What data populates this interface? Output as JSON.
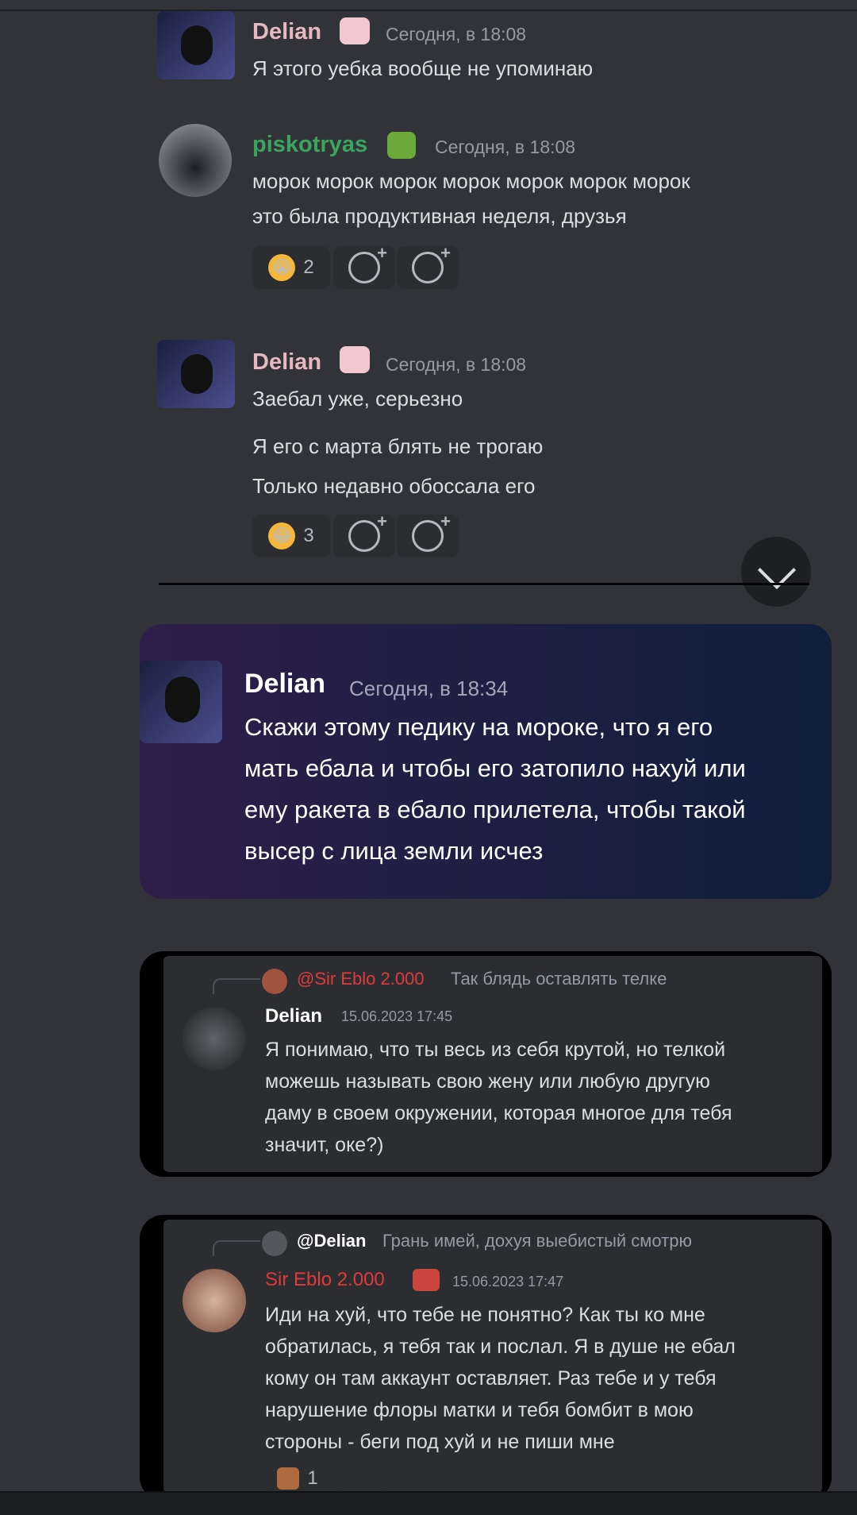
{
  "messages": [
    {
      "user": "Delian",
      "time": "Сегодня, в 18:08",
      "text": "Я этого уебка вообще не упоминаю",
      "name_color": "#e6b8c0"
    },
    {
      "user": "piskotryas",
      "time": "Сегодня, в 18:08",
      "lines": [
        "морок морок морок морок морок морок морок",
        "это была продуктивная неделя, друзья"
      ],
      "name_color": "#3ba55d",
      "reaction_count": "2"
    },
    {
      "user": "Delian",
      "time": "Сегодня, в 18:08",
      "lines": [
        "Заебал уже, серьезно",
        "Я его с марта блять не трогаю",
        "Только недавно обоссала его"
      ],
      "reaction_count": "3"
    }
  ],
  "featured": {
    "user": "Delian",
    "time": "Сегодня, в 18:34",
    "lines": [
      "Скажи этому педику на мороке, что я его",
      "мать ебала и чтобы его затопило нахуй или",
      "ему ракета в ебало прилетела, чтобы такой",
      "высер с лица земли исчез"
    ]
  },
  "reply1": {
    "reply_user": "@Sir Eblo 2.000",
    "reply_text": "Так блядь оставлять телке",
    "user": "Delian",
    "time": "15.06.2023 17:45",
    "lines": [
      "Я понимаю, что ты весь из себя крутой, но телкой",
      "можешь называть свою жену или любую другую",
      "даму в своем окружении, которая многое для тебя",
      "значит, оке?)"
    ]
  },
  "reply2": {
    "reply_user": "@Delian",
    "reply_text": "Грань имей, дохуя выебистый смотрю",
    "user": "Sir Eblo 2.000",
    "time": "15.06.2023 17:47",
    "lines": [
      "Иди на хуй, что тебе не понятно? Как ты ко мне",
      "обратилась, я тебя так и послал. Я в душе не ебал",
      "кому он там аккаунт оставляет. Раз тебе и у тебя",
      "нарушение флоры матки и тебя бомбит в мою",
      "стороны - беги под хуй и не пиши мне"
    ],
    "name_color": "#e03a3a",
    "reaction_count": "1"
  }
}
